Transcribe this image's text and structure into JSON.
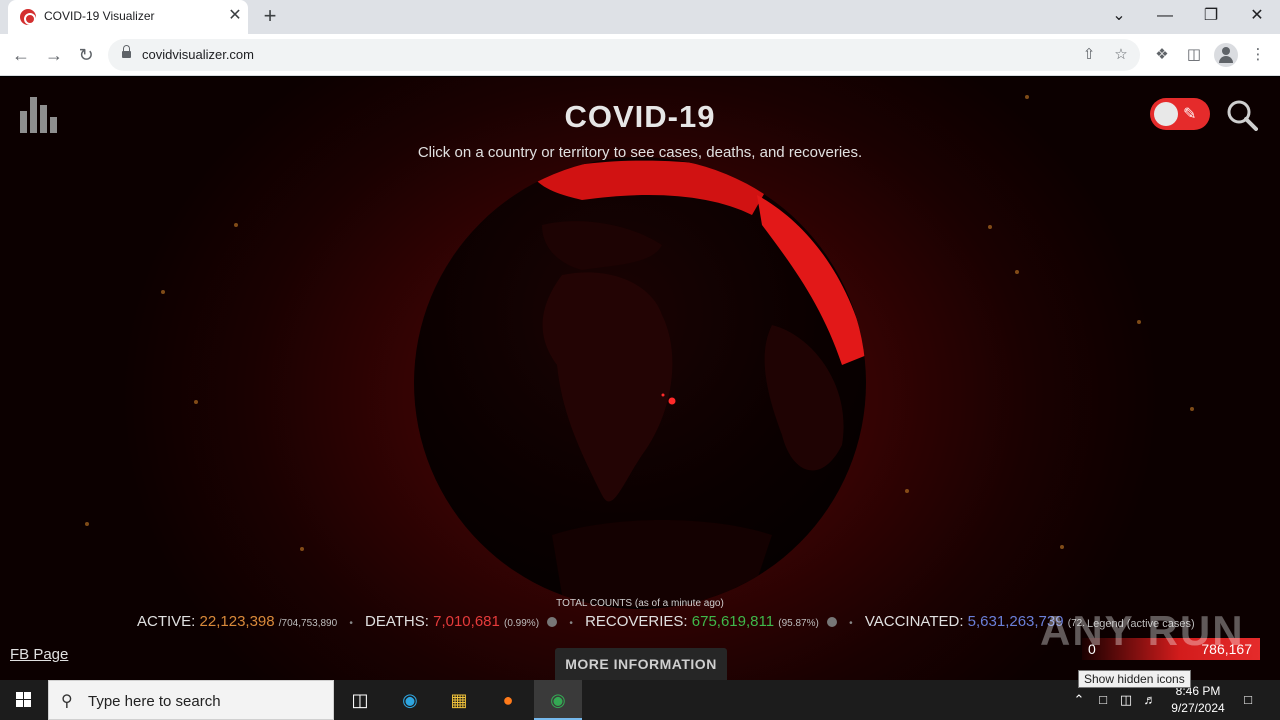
{
  "browser": {
    "tab_title": "COVID-19 Visualizer",
    "tab_close": "✕",
    "new_tab": "+",
    "url": "covidvisualizer.com",
    "window_controls": {
      "dropdown": "⌄",
      "minimize": "—",
      "restore": "❐",
      "close": "✕"
    }
  },
  "page": {
    "title": "COVID-19",
    "subtitle": "Click on a country or territory to see cases, deaths, and recoveries.",
    "total_counts_label": "TOTAL COUNTS (as of a minute ago)",
    "stats": {
      "active_label": "ACTIVE:",
      "active_value": "22,123,398",
      "active_total": "/704,753,890",
      "deaths_label": "DEATHS:",
      "deaths_value": "7,010,681",
      "deaths_pct": "(0.99%)",
      "recoveries_label": "RECOVERIES:",
      "recoveries_value": "675,619,811",
      "recoveries_pct": "(95.87%)",
      "vaccinated_label": "VACCINATED:",
      "vaccinated_value": "5,631,263,739",
      "vaccinated_pct": "(72."
    },
    "legend": {
      "label": "Legend (active cases)",
      "min": "0",
      "max": "786,167"
    },
    "fb_link": "FB Page",
    "more_info_button": "MORE INFORMATION",
    "watermark": "ANY RUN",
    "colors": {
      "active": "#d9893a",
      "deaths": "#e53b3b",
      "recoveries": "#3fb84a",
      "vaccinated": "#6a7fd8",
      "toggle": "#e52b2b"
    }
  },
  "taskbar": {
    "search_placeholder": "Type here to search",
    "tooltip": "Show hidden icons",
    "time": "8:46 PM",
    "date": "9/27/2024",
    "apps": [
      "task-view-icon",
      "edge-icon",
      "file-explorer-icon",
      "firefox-icon",
      "chrome-icon"
    ]
  }
}
